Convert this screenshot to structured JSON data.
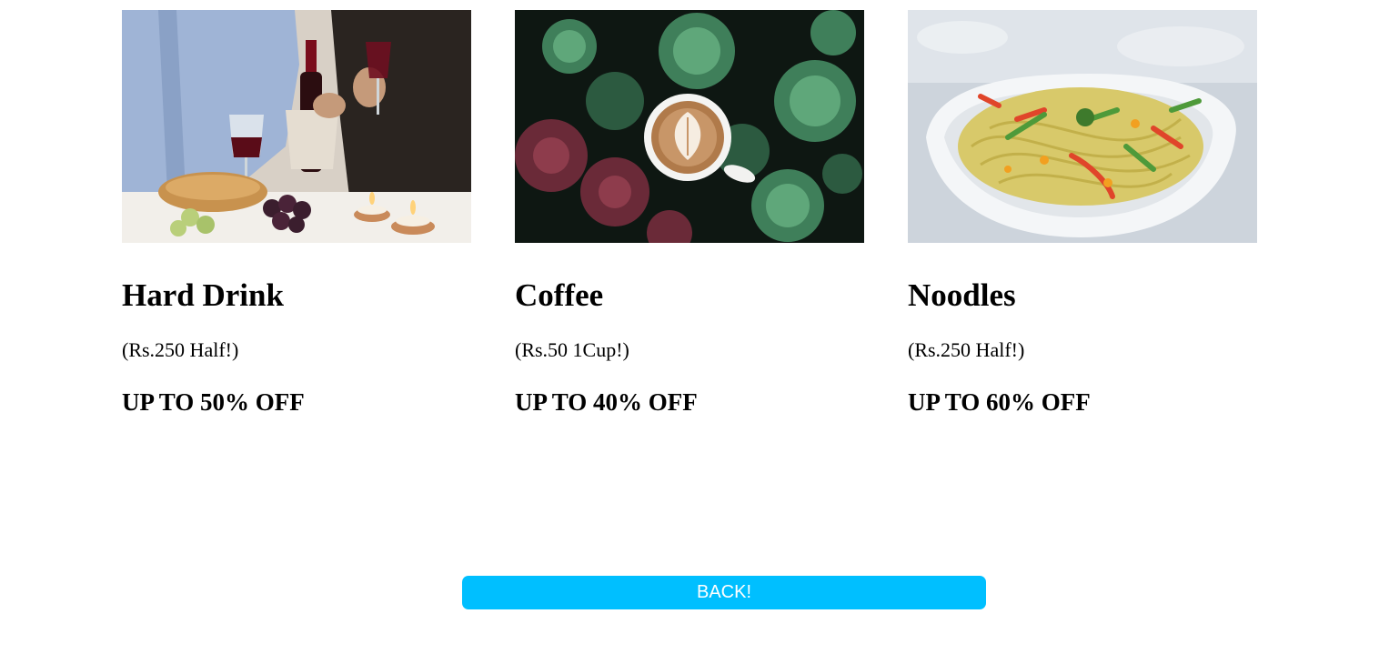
{
  "items": [
    {
      "title": "Hard Drink",
      "price": "(Rs.250 Half!)",
      "offer": "UP TO 50% OFF",
      "image": "wine-bottle-dinner-photo"
    },
    {
      "title": "Coffee",
      "price": "(Rs.50 1Cup!)",
      "offer": "UP TO 40% OFF",
      "image": "latte-among-succulents-photo"
    },
    {
      "title": "Noodles",
      "price": "(Rs.250 Half!)",
      "offer": "UP TO 60% OFF",
      "image": "noodle-bowl-photo"
    }
  ],
  "back_button": {
    "label": "BACK!",
    "color": "#00bfff",
    "text_color": "#ffffff"
  }
}
